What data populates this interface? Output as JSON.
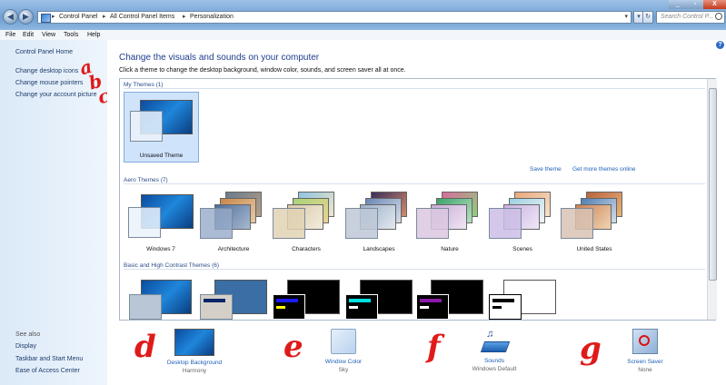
{
  "colors": {
    "link": "#1e5fb8",
    "annotation": "#e01a1a",
    "heading": "#1e3d8f",
    "sidebar_bg": "#dbe9f8"
  },
  "window": {
    "minimize": "_",
    "maximize": "▫",
    "close": "X"
  },
  "addressbar": {
    "crumbs": [
      "Control Panel",
      "All Control Panel Items",
      "Personalization"
    ],
    "refresh": "↻"
  },
  "search": {
    "placeholder": "Search Control P..."
  },
  "menubar": [
    "File",
    "Edit",
    "View",
    "Tools",
    "Help"
  ],
  "sidebar": {
    "home": "Control Panel Home",
    "links": [
      "Change desktop icons",
      "Change mouse pointers",
      "Change your account picture"
    ],
    "see_also_title": "See also",
    "see_also": [
      "Display",
      "Taskbar and Start Menu",
      "Ease of Access Center"
    ]
  },
  "annotations": [
    "a",
    "b",
    "c",
    "d",
    "e",
    "f",
    "g"
  ],
  "main": {
    "title": "Change the visuals and sounds on your computer",
    "subtitle": "Click a theme to change the desktop background, window color, sounds, and screen saver all at once.",
    "help": "?"
  },
  "themes": {
    "my_themes_title": "My Themes (1)",
    "my_themes": [
      "Unsaved Theme"
    ],
    "save_theme": "Save theme",
    "get_more": "Get more themes online",
    "aero_title": "Aero Themes (7)",
    "aero": [
      "Windows 7",
      "Architecture",
      "Characters",
      "Landscapes",
      "Nature",
      "Scenes",
      "United States"
    ],
    "contrast_title": "Basic and High Contrast Themes (6)"
  },
  "bottom": [
    {
      "label": "Desktop Background",
      "value": "Harmony",
      "icon": "desktop-background-icon"
    },
    {
      "label": "Window Color",
      "value": "Sky",
      "icon": "window-color-icon"
    },
    {
      "label": "Sounds",
      "value": "Windows Default",
      "icon": "sounds-icon"
    },
    {
      "label": "Screen Saver",
      "value": "None",
      "icon": "screen-saver-icon"
    }
  ]
}
